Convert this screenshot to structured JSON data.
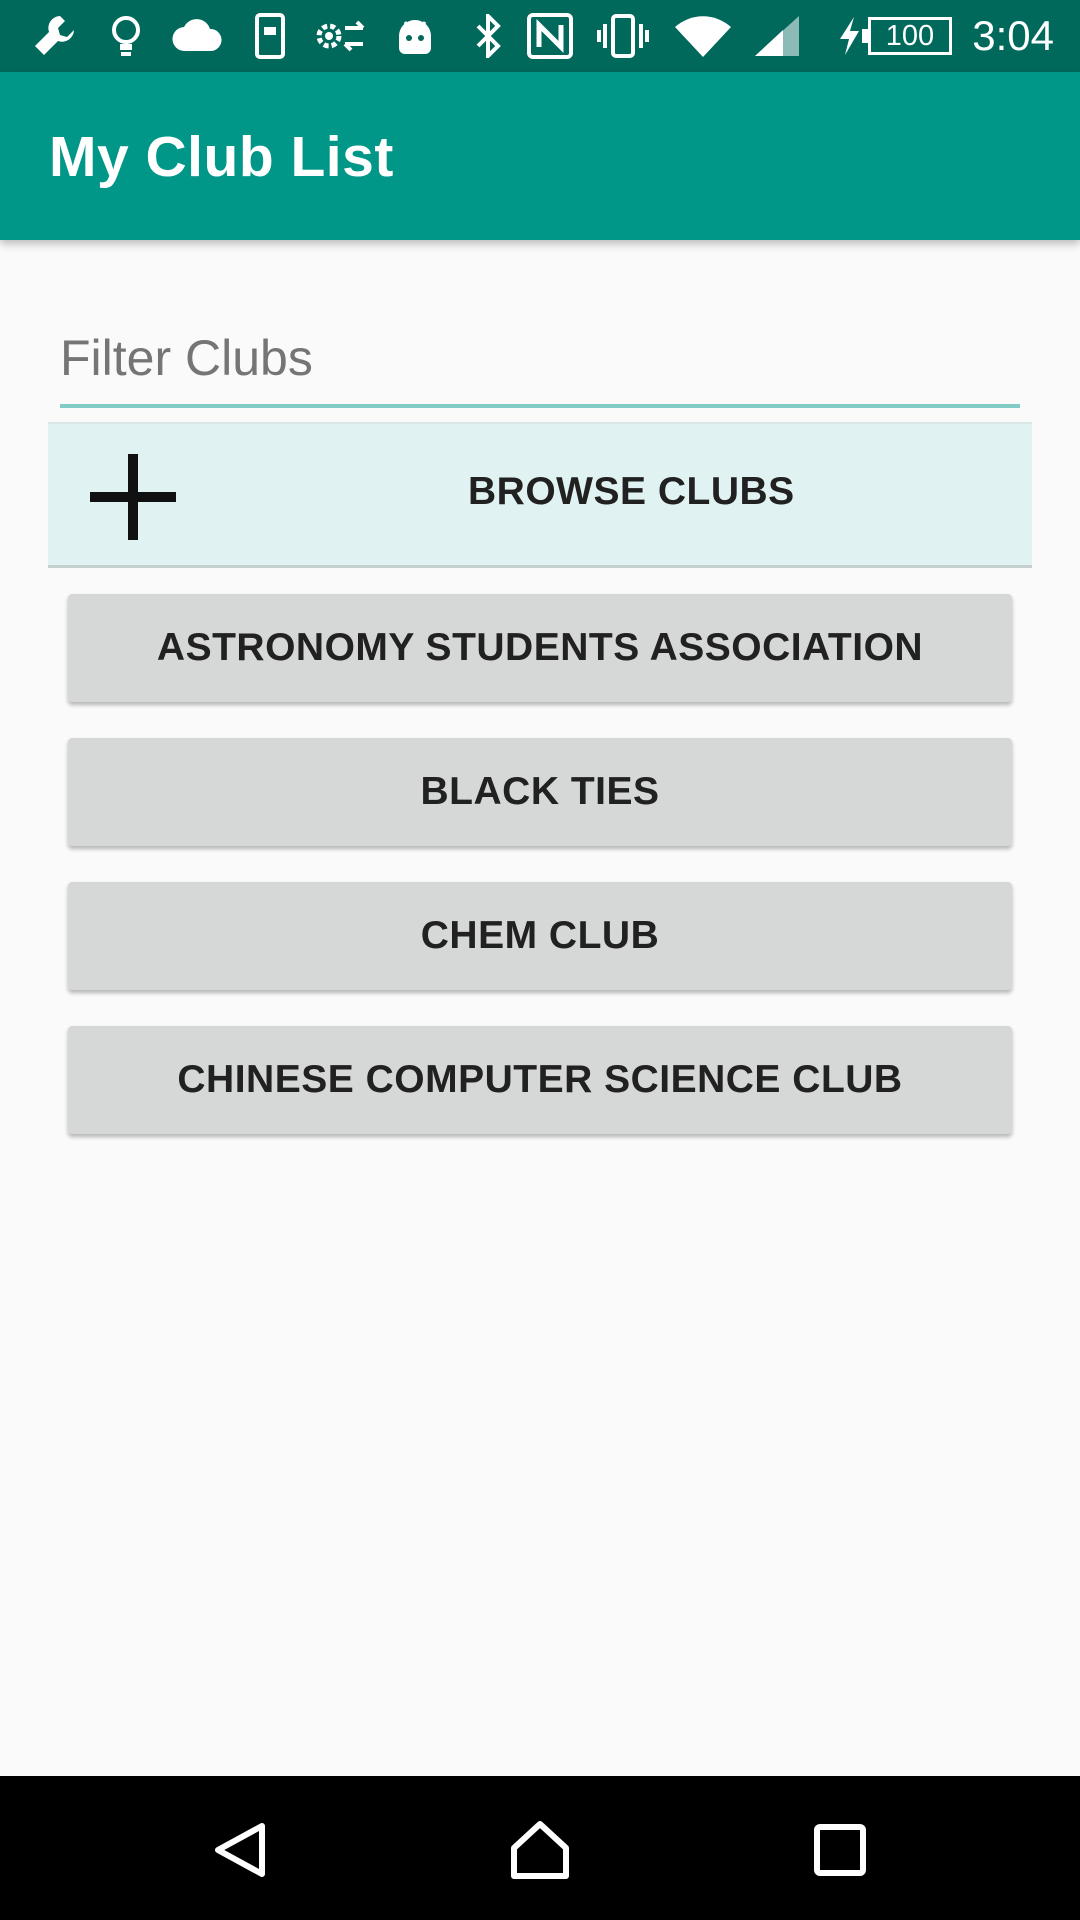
{
  "status_bar": {
    "time": "3:04",
    "battery_level": "100",
    "icons": [
      "wrench-icon",
      "lightbulb-icon",
      "cloud-icon",
      "device-icon",
      "settings-sync-icon",
      "android-icon",
      "bluetooth-icon",
      "nfc-icon",
      "vibrate-icon",
      "wifi-icon",
      "signal-icon",
      "charging-icon",
      "battery-icon"
    ]
  },
  "app_bar": {
    "title": "My Club List",
    "color": "#009688"
  },
  "filter": {
    "placeholder": "Filter Clubs",
    "value": ""
  },
  "browse": {
    "label": "BROWSE CLUBS",
    "icon": "plus-icon"
  },
  "clubs": [
    {
      "label": "ASTRONOMY STUDENTS ASSOCIATION"
    },
    {
      "label": "BLACK TIES"
    },
    {
      "label": "CHEM CLUB"
    },
    {
      "label": "CHINESE COMPUTER SCIENCE CLUB"
    }
  ],
  "nav_bar": {
    "icons": [
      "back-icon",
      "home-icon",
      "recents-icon"
    ]
  }
}
